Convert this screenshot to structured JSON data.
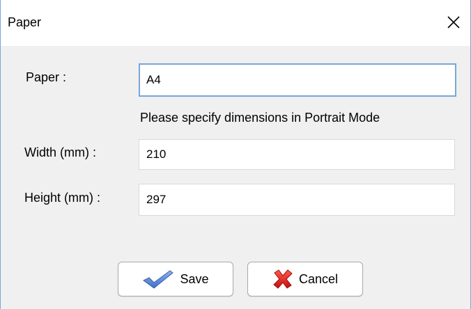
{
  "window": {
    "title": "Paper",
    "close_icon": "close-icon"
  },
  "form": {
    "paper_label": "Paper :",
    "paper_value": "A4",
    "hint": "Please specify dimensions in Portrait Mode",
    "width_label": "Width (mm) :",
    "width_value": "210",
    "height_label": "Height (mm) :",
    "height_value": "297"
  },
  "buttons": {
    "save_label": "Save",
    "save_icon": "checkmark-icon",
    "cancel_label": "Cancel",
    "cancel_icon": "x-mark-icon"
  },
  "colors": {
    "focus_border": "#7aa6d6",
    "dialog_background": "#f0f0f0",
    "checkmark": "#4f7fd6",
    "cancel_x": "#e02020"
  }
}
